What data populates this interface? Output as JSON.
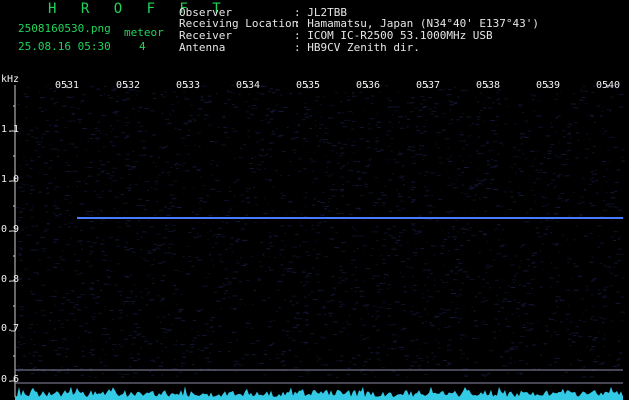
{
  "header": {
    "program_title": "H R O F F T",
    "filename": "2508160530.png",
    "datetime": "25.08.16 05:30",
    "meteor_label": "meteor",
    "meteor_count": "4",
    "info": {
      "observer_label": "Observer",
      "observer_value": ": JL2TBB",
      "location_label": "Receiving Location",
      "location_value": ": Hamamatsu, Japan (N34°40' E137°43')",
      "receiver_label": "Receiver",
      "receiver_value": ": ICOM IC-R2500 53.1000MHz USB",
      "antenna_label": "Antenna",
      "antenna_value": ": HB9CV Zenith dir."
    }
  },
  "spectrogram": {
    "y_unit": "kHz",
    "y_ticks": [
      "1.1",
      "1.0",
      "0.9",
      "0.8",
      "0.7",
      "0.6"
    ],
    "x_ticks": [
      "0531",
      "0532",
      "0533",
      "0534",
      "0535",
      "0536",
      "0537",
      "0538",
      "0539",
      "0540"
    ],
    "colors": {
      "background": "#000000",
      "noise": "#141a3c",
      "carrier": "#3a6cff",
      "axis": "#d0d0d0",
      "band_lines": "#8a8aa8",
      "signal_bar": "#38e0ff"
    }
  }
}
